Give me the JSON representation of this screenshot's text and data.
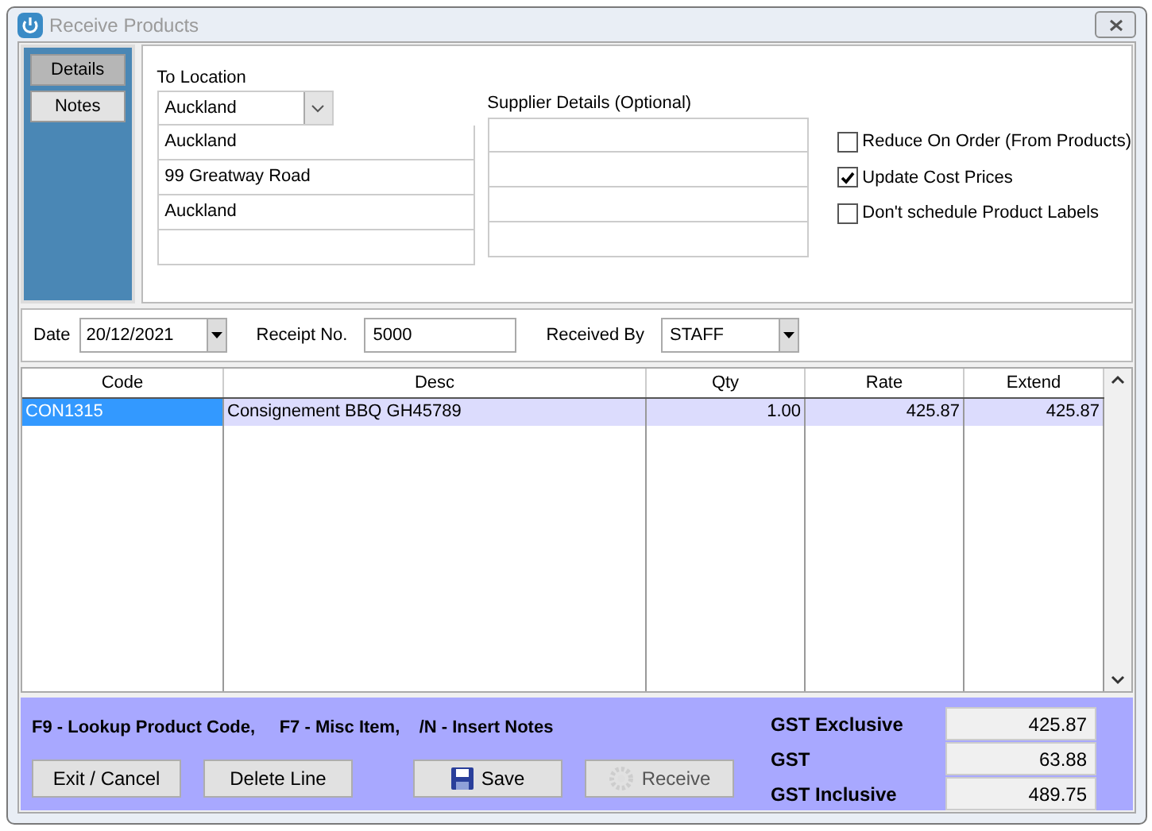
{
  "window": {
    "title": "Receive Products"
  },
  "side_tabs": [
    {
      "label": "Details",
      "selected": true
    },
    {
      "label": "Notes",
      "selected": false
    }
  ],
  "location": {
    "label": "To Location",
    "value": "Auckland",
    "lines": [
      "Auckland",
      "99 Greatway Road",
      "Auckland"
    ]
  },
  "supplier": {
    "label": "Supplier Details (Optional)"
  },
  "options": [
    {
      "label": "Reduce On Order (From Products)",
      "checked": false
    },
    {
      "label": "Update Cost Prices",
      "checked": true
    },
    {
      "label": "Don't schedule Product Labels",
      "checked": false
    }
  ],
  "date": {
    "label": "Date",
    "value": "20/12/2021"
  },
  "receipt": {
    "label": "Receipt No.",
    "value": "5000"
  },
  "received_by": {
    "label": "Received By",
    "value": "STAFF"
  },
  "table": {
    "columns": [
      "Code",
      "Desc",
      "Qty",
      "Rate",
      "Extend"
    ],
    "rows": [
      {
        "cells": [
          "CON1315",
          "Consignement BBQ GH45789",
          "1.00",
          "425.87",
          "425.87"
        ],
        "selected": true
      }
    ]
  },
  "hint": "F9 - Lookup Product Code,     F7 - Misc Item,    /N - Insert Notes",
  "buttons": [
    {
      "label": "Exit / Cancel",
      "kind": "plain",
      "disabled": false
    },
    {
      "label": "Delete Line",
      "kind": "plain",
      "disabled": false
    },
    {
      "label": "Save",
      "kind": "save",
      "disabled": false
    },
    {
      "label": "Receive",
      "kind": "receive",
      "disabled": true
    }
  ],
  "totals": [
    {
      "label": "GST Exclusive",
      "value": "425.87"
    },
    {
      "label": "GST",
      "value": "63.88"
    },
    {
      "label": "GST Inclusive",
      "value": "489.75"
    }
  ]
}
